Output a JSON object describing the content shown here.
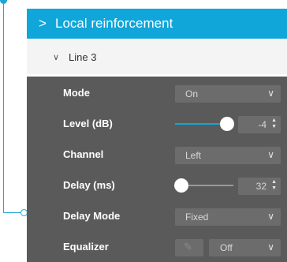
{
  "header": {
    "title": "Local reinforcement",
    "chevron_icon": "chevron-right-icon"
  },
  "line": {
    "label": "Line 3",
    "chevron_icon": "chevron-down-icon"
  },
  "colors": {
    "accent": "#10a6da",
    "panel": "#5a5a5a",
    "control": "#6c6c6c"
  },
  "settings": {
    "mode": {
      "label": "Mode",
      "value": "On"
    },
    "level": {
      "label": "Level (dB)",
      "value": "-4",
      "fraction": 0.84
    },
    "channel": {
      "label": "Channel",
      "value": "Left"
    },
    "delay": {
      "label": "Delay (ms)",
      "value": "32",
      "fraction": 0.0
    },
    "delay_mode": {
      "label": "Delay Mode",
      "value": "Fixed"
    },
    "equalizer": {
      "label": "Equalizer",
      "value": "Off"
    }
  }
}
